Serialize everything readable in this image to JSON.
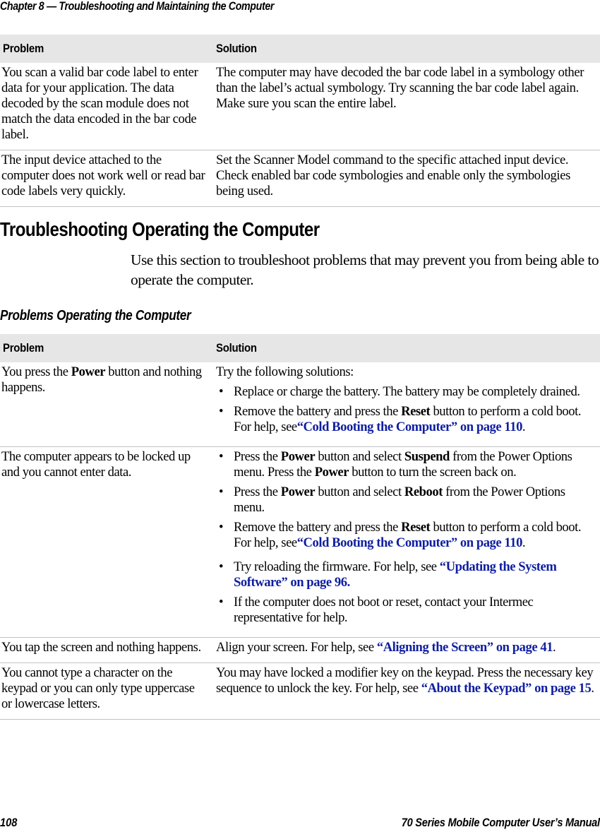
{
  "header": {
    "running_title": "Chapter 8 — Troubleshooting and Maintaining the Computer"
  },
  "table1": {
    "columns": [
      "Problem",
      "Solution"
    ],
    "rows": [
      {
        "problem": "You scan a valid bar code label to enter data for your application. The data decoded by the scan module does not match the data encoded in the bar code label.",
        "solution": "The computer may have decoded the bar code label in a symbology other than the label’s actual symbology. Try scanning the bar code label again. Make sure you scan the entire label."
      },
      {
        "problem": "The input device attached to the computer does not work well or read bar code labels very quickly.",
        "solution": "Set the Scanner Model command to the specific attached input device. Check enabled bar code symbologies and enable only the symbologies being used."
      }
    ]
  },
  "section": {
    "heading": "Troubleshooting Operating the Computer",
    "intro": "Use this section to troubleshoot problems that may prevent you from being able to operate the computer."
  },
  "table2": {
    "caption": "Problems Operating the Computer",
    "columns": [
      "Problem",
      "Solution"
    ],
    "rows": [
      {
        "problem": {
          "pre": "You press the ",
          "bold": "Power",
          "post": " button and nothing happens."
        },
        "solution": {
          "lead": "Try the following solutions:",
          "bullets": [
            {
              "text": "Replace or charge the battery. The battery may be completely drained."
            },
            {
              "pre": "Remove the battery and press the ",
              "bold": "Reset",
              "mid": " button to perform a cold boot. For help, see",
              "link": "“Cold Booting the Computer” on page 110",
              "post": "."
            }
          ]
        }
      },
      {
        "problem": {
          "text": "The computer appears to be locked up and you cannot enter data."
        },
        "solution": {
          "bullets": [
            {
              "p1": "Press the ",
              "b1": "Power",
              "p2": " button and select ",
              "b2": "Suspend",
              "p3": " from the Power Options menu. Press the ",
              "b3": "Power",
              "p4": " button to turn the screen back on."
            },
            {
              "p1": "Press the ",
              "b1": "Power",
              "p2": " button and select ",
              "b2": "Reboot",
              "p3": " from the Power Options menu."
            },
            {
              "pre": "Remove the battery and press the ",
              "bold": "Reset",
              "mid": " button to perform a cold boot. For help, see",
              "link": "“Cold Booting the Computer” on page 110",
              "post": "."
            },
            {
              "pre": "Try reloading the firmware. For help, see ",
              "link": "“Updating the System Software” on page 96."
            },
            {
              "text": "If the computer does not boot or reset, contact your Intermec representative for help."
            }
          ]
        }
      },
      {
        "problem": {
          "text": "You tap the screen and nothing happens."
        },
        "solution": {
          "pre": "Align your screen. For help, see ",
          "link": "“Aligning the Screen” on page 41",
          "post": "."
        }
      },
      {
        "problem": {
          "text": "You cannot type a character on the keypad or you can only type uppercase or lowercase letters."
        },
        "solution": {
          "pre": "You may have locked a modifier key on the keypad. Press the necessary key sequence to unlock the key. For help, see ",
          "link": "“About the Keypad” on page 15",
          "post": "."
        }
      }
    ]
  },
  "footer": {
    "page_number": "108",
    "manual_title": "70 Series Mobile Computer User’s Manual"
  },
  "colors": {
    "link": "#0f1ea0",
    "table_header_bg": "#e6e6e6",
    "row_divider": "#c2c2c2"
  }
}
